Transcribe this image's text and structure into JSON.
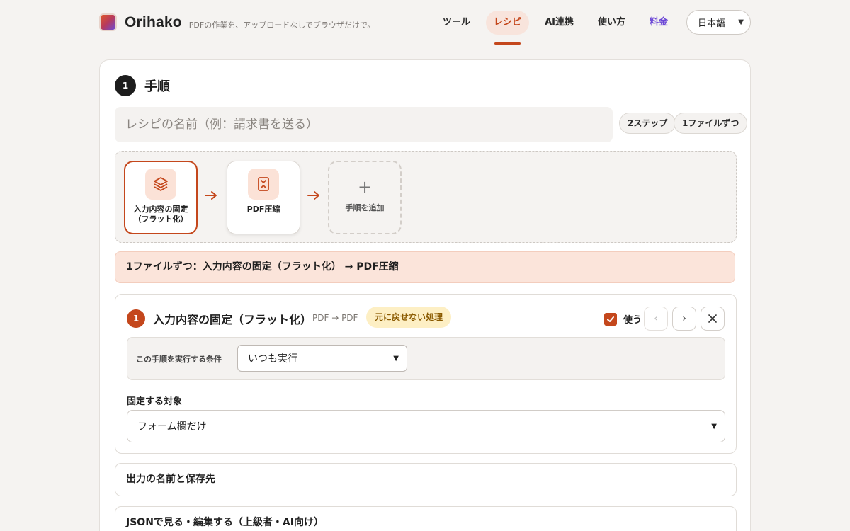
{
  "header": {
    "brand": "Orihako",
    "tagline": "PDFの作業を、アップロードなしでブラウザだけで。",
    "nav": [
      {
        "label": "ツール"
      },
      {
        "label": "レシピ",
        "active": true
      },
      {
        "label": "AI連携"
      },
      {
        "label": "使い方"
      },
      {
        "label": "料金"
      }
    ],
    "language": "日本語"
  },
  "section": {
    "number": "1",
    "title": "手順"
  },
  "recipe": {
    "name_placeholder": "レシピの名前（例：請求書を送る）",
    "chips": [
      "2ステップ",
      "1ファイルずつ"
    ]
  },
  "flow": {
    "steps": [
      {
        "label_line1": "入力内容の固定",
        "label_line2": "（フラット化）",
        "icon": "layers-icon",
        "selected": true
      },
      {
        "label_line1": "PDF圧縮",
        "label_line2": "",
        "icon": "compress-file-icon",
        "selected": false
      }
    ],
    "add_label": "手順を追加"
  },
  "summary": "1ファイルずつ：入力内容の固定（フラット化） → PDF圧縮",
  "step_detail": {
    "number": "1",
    "title": "入力内容の固定（フラット化）",
    "io": "PDF → PDF",
    "warning": "元に戻せない処理",
    "use_label": "使う",
    "use_checked": true,
    "condition_label": "この手順を実行する条件",
    "condition_value": "いつも実行",
    "target_label": "固定する対象",
    "target_value": "フォーム欄だけ"
  },
  "accordions": [
    {
      "label": "出力の名前と保存先"
    },
    {
      "label": "JSONで見る・編集する（上級者・AI向け）"
    }
  ],
  "colors": {
    "accent": "#c4471c",
    "pricing": "#6b46d6",
    "warning_bg": "#fdefc4"
  }
}
